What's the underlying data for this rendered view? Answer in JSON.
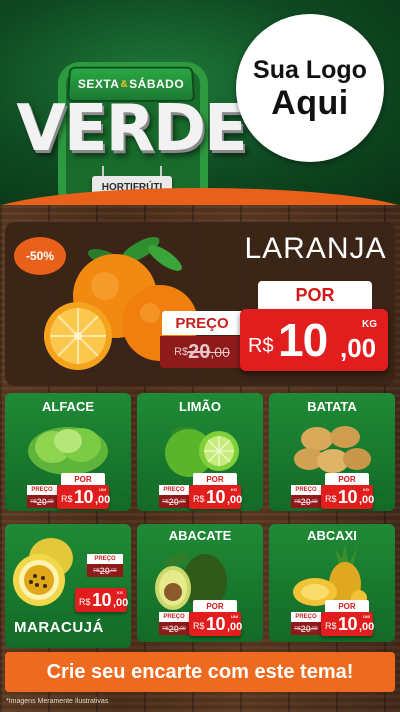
{
  "header": {
    "tag_left": "SEXTA",
    "tag_amp": "&",
    "tag_right": "SÁBADO",
    "title": "VERDE",
    "sign": "HORTIFRÚTI",
    "logo_line1": "Sua Logo",
    "logo_line2": "Aqui"
  },
  "featured": {
    "discount": "-50%",
    "name": "LARANJA",
    "por_label": "POR",
    "preco_label": "PREÇO",
    "old_currency": "R$",
    "old_int": "20",
    "old_cents": ",00",
    "currency": "R$",
    "new_int": "10",
    "new_cents": ",00",
    "unit": "KG"
  },
  "products": [
    {
      "name": "ALFACE",
      "por": "POR",
      "preco": "PREÇO",
      "old_currency": "R$",
      "old_int": "20",
      "old_cents": ",00",
      "currency": "R$",
      "new_int": "10",
      "new_cents": ",00",
      "unit": "UNI"
    },
    {
      "name": "LIMÃO",
      "por": "POR",
      "preco": "PREÇO",
      "old_currency": "R$",
      "old_int": "20",
      "old_cents": ",00",
      "currency": "R$",
      "new_int": "10",
      "new_cents": ",00",
      "unit": "KG"
    },
    {
      "name": "BATATA",
      "por": "POR",
      "preco": "PREÇO",
      "old_currency": "R$",
      "old_int": "20",
      "old_cents": ",00",
      "currency": "R$",
      "new_int": "10",
      "new_cents": ",00",
      "unit": "KG"
    },
    {
      "name": "MARACUJÁ",
      "preco": "PREÇO",
      "old_currency": "R$",
      "old_int": "20",
      "old_cents": ",00",
      "currency": "R$",
      "new_int": "10",
      "new_cents": ",00",
      "unit": "KG"
    },
    {
      "name": "ABACATE",
      "por": "POR",
      "preco": "PREÇO",
      "old_currency": "R$",
      "old_int": "20",
      "old_cents": ",00",
      "currency": "R$",
      "new_int": "10",
      "new_cents": ",00",
      "unit": "UNI"
    },
    {
      "name": "ABCAXI",
      "por": "POR",
      "preco": "PREÇO",
      "old_currency": "R$",
      "old_int": "20",
      "old_cents": ",00",
      "currency": "R$",
      "new_int": "10",
      "new_cents": ",00",
      "unit": "UNI"
    }
  ],
  "cta": "Crie seu encarte com este tema!",
  "disclaimer": "*Imagens Meramente Ilustrativas",
  "colors": {
    "header_green": "#0f4a22",
    "card_green": "#1f8a36",
    "price_red": "#e11d1d",
    "old_price_red": "#8f1a1a",
    "accent_orange": "#ee6a1f",
    "wood_brown": "#4a2d19"
  }
}
